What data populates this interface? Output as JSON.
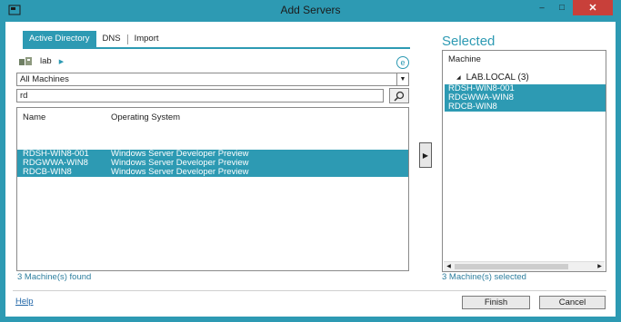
{
  "window": {
    "title": "Add Servers",
    "controls": {
      "minimize": "–",
      "maximize": "□",
      "close": "✕"
    }
  },
  "tabs": [
    "Active Directory",
    "DNS",
    "Import"
  ],
  "breadcrumb": {
    "domain": "lab",
    "arrow": "▶"
  },
  "filter": {
    "selected": "All Machines",
    "dropdown": "▼"
  },
  "search": {
    "value": "rd"
  },
  "results": {
    "columns": [
      "Name",
      "Operating System"
    ],
    "rows": [
      {
        "name": "RDSH-WIN8-001",
        "os": "Windows Server Developer Preview"
      },
      {
        "name": "RDGWWA-WIN8",
        "os": "Windows Server Developer Preview"
      },
      {
        "name": "RDCB-WIN8",
        "os": "Windows Server Developer Preview"
      }
    ],
    "status": "3 Machine(s) found"
  },
  "move_button": "▶",
  "selected": {
    "title": "Selected",
    "column": "Machine",
    "group": "LAB.LOCAL (3)",
    "items": [
      "RDSH-WIN8-001",
      "RDGWWA-WIN8",
      "RDCB-WIN8"
    ],
    "status": "3 Machine(s) selected"
  },
  "footer": {
    "help": "Help",
    "finish": "Finish",
    "cancel": "Cancel"
  },
  "colors": {
    "accent": "#2d9ab3",
    "close_button": "#c8403a",
    "link": "#2267a8"
  },
  "icons": [
    "app-icon",
    "domain-icon",
    "refresh-icon",
    "search-icon",
    "move-right-icon"
  ]
}
